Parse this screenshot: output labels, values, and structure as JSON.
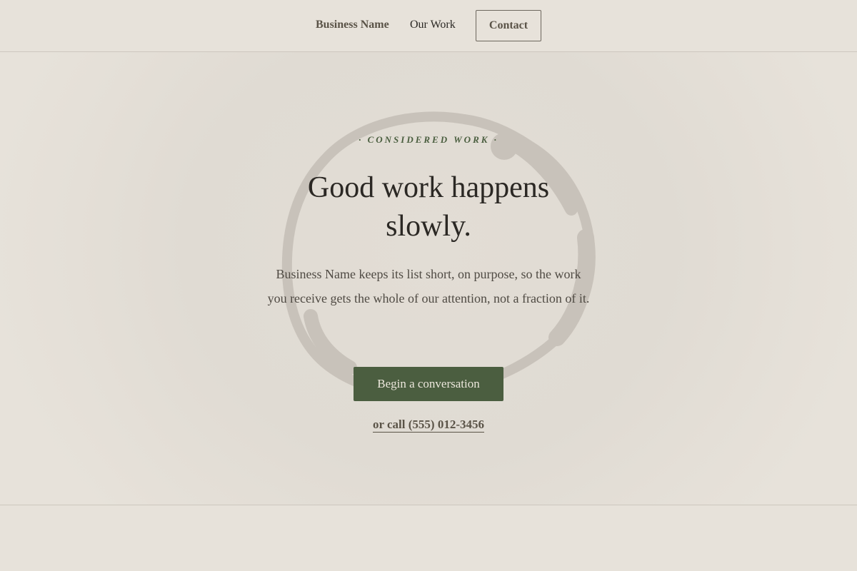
{
  "nav": {
    "brand": "Business Name",
    "our_work": "Our Work",
    "contact": "Contact"
  },
  "hero": {
    "eyebrow": "· CONSIDERED WORK ·",
    "headline": "Good work happens slowly.",
    "lede": "Business Name keeps its list short, on purpose, so the work you receive gets the whole of our attention, not a fraction of it.",
    "cta_label": "Begin a conversation",
    "call_text": "or call (555) 012-3456"
  },
  "colors": {
    "background": "#e7e2da",
    "accent_green": "#4b5e40",
    "text_dark": "#2b2824",
    "text_muted": "#5a5347",
    "ring": "#c8c2ba"
  }
}
